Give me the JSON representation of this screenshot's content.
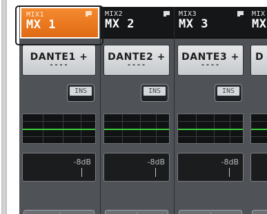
{
  "channels": [
    {
      "mix_label": "MIX1",
      "name": "MX 1",
      "selected": true,
      "patch_name": "DANTE1 +",
      "patch_sub": "----",
      "ins_label": "INS",
      "level": "-8dB"
    },
    {
      "mix_label": "MIX2",
      "name": "MX 2",
      "selected": false,
      "patch_name": "DANTE2 +",
      "patch_sub": "----",
      "ins_label": "INS",
      "level": "-8dB"
    },
    {
      "mix_label": "MIX3",
      "name": "MX 3",
      "selected": false,
      "patch_name": "DANTE3 +",
      "patch_sub": "----",
      "ins_label": "INS",
      "level": "-8dB"
    },
    {
      "mix_label": "MIX",
      "name": "MX",
      "selected": false,
      "patch_name": "D"
    }
  ],
  "colors": {
    "selected_header": "#ee7a22",
    "header_dark": "#151617",
    "strip_body": "#4f5357",
    "eq_curve": "#3fd13f"
  },
  "icons": {
    "header_marker": "channel-marker-icon"
  }
}
